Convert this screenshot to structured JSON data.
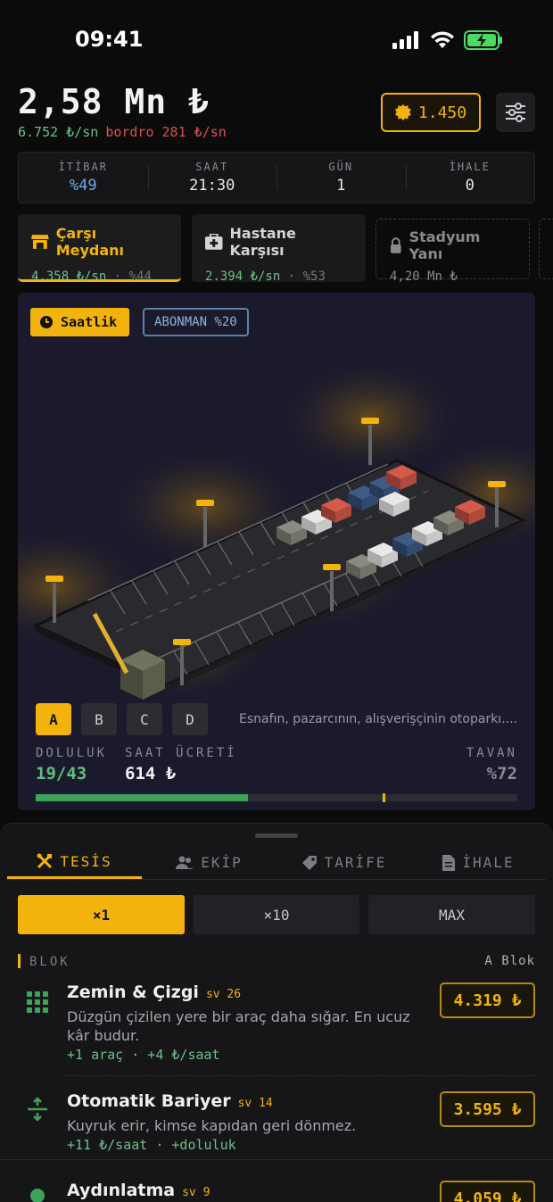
{
  "status_bar": {
    "time": "09:41"
  },
  "header": {
    "balance": "2,58 Mn ₺",
    "income_rate": "6.752 ₺/sn",
    "payroll": "bordro 281 ₺/sn",
    "coins": "1.450"
  },
  "stats": [
    {
      "label": "İTİBAR",
      "value": "%49"
    },
    {
      "label": "SAAT",
      "value": "21:30"
    },
    {
      "label": "GÜN",
      "value": "1"
    },
    {
      "label": "İHALE",
      "value": "0"
    }
  ],
  "locations": [
    {
      "name": "Çarşı Meydanı",
      "rate": "4.358 ₺/sn",
      "share": "%44",
      "icon": "store-icon"
    },
    {
      "name": "Hastane Karşısı",
      "rate": "2.394 ₺/sn",
      "share": "%53",
      "icon": "medkit-icon"
    },
    {
      "name": "Stadyum Yanı",
      "price": "4,20 Mn ₺",
      "icon": "lock-icon"
    }
  ],
  "scene": {
    "mode_label": "Saatlik",
    "subscription_label": "ABONMAN %20",
    "blocks": [
      "A",
      "B",
      "C",
      "D"
    ],
    "selected_block": "A",
    "description": "Esnafın, pazarcının, alışverişçinin otoparkı....",
    "occupancy_label": "DOLULUK",
    "occupancy_value": "19/43",
    "occupancy_fraction": 0.44,
    "fee_label": "SAAT ÜCRETİ",
    "fee_value": "614 ₺",
    "cap_label": "TAVAN",
    "cap_value": "%72",
    "cap_fraction": 0.72,
    "colors": {
      "accent": "#f2b40c",
      "occupancy": "#3ea35a"
    }
  },
  "sheet": {
    "tabs": [
      {
        "label": "TESİS",
        "icon": "tools-icon"
      },
      {
        "label": "EKİP",
        "icon": "team-icon"
      },
      {
        "label": "TARİFE",
        "icon": "tag-icon"
      },
      {
        "label": "İHALE",
        "icon": "document-icon"
      }
    ],
    "quantities": [
      "×1",
      "×10",
      "MAX"
    ],
    "section_label": "BLOK",
    "section_value": "A Blok",
    "items": [
      {
        "title": "Zemin & Çizgi",
        "level": "sv 26",
        "text": "Düzgün çizilen yere bir araç daha sığar. En ucuz kâr budur.",
        "effect": "+1 araç · +4 ₺/saat",
        "price": "4.319 ₺",
        "icon": "grid-icon"
      },
      {
        "title": "Otomatik Bariyer",
        "level": "sv 14",
        "text": "Kuyruk erir, kimse kapıdan geri dönmez.",
        "effect": "+11 ₺/saat · +doluluk",
        "price": "3.595 ₺",
        "icon": "barrier-arrows-icon"
      },
      {
        "title": "Aydınlatma",
        "level": "sv 9",
        "price": "4.059 ₺",
        "icon": "bulb-icon"
      }
    ]
  }
}
